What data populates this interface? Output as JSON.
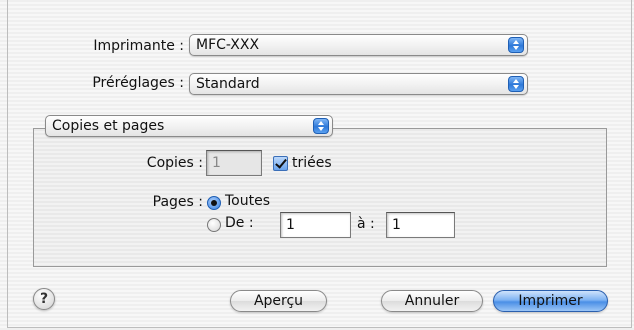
{
  "printer": {
    "label": "Imprimante :",
    "value": "MFC-XXX"
  },
  "presets": {
    "label": "Préréglages :",
    "value": "Standard"
  },
  "panel_menu": {
    "value": "Copies et pages"
  },
  "copies": {
    "label": "Copies :",
    "value": "1",
    "collated_label": "triées",
    "collated": true
  },
  "pages": {
    "label": "Pages :",
    "all_label": "Toutes",
    "from_label": "De :",
    "from_value": "1",
    "to_label": "à :",
    "to_value": "1",
    "selected": "Toutes"
  },
  "buttons": {
    "help": "?",
    "preview": "Aperçu",
    "cancel": "Annuler",
    "print": "Imprimer"
  },
  "colors": {
    "accent": "#4a8fe6"
  }
}
